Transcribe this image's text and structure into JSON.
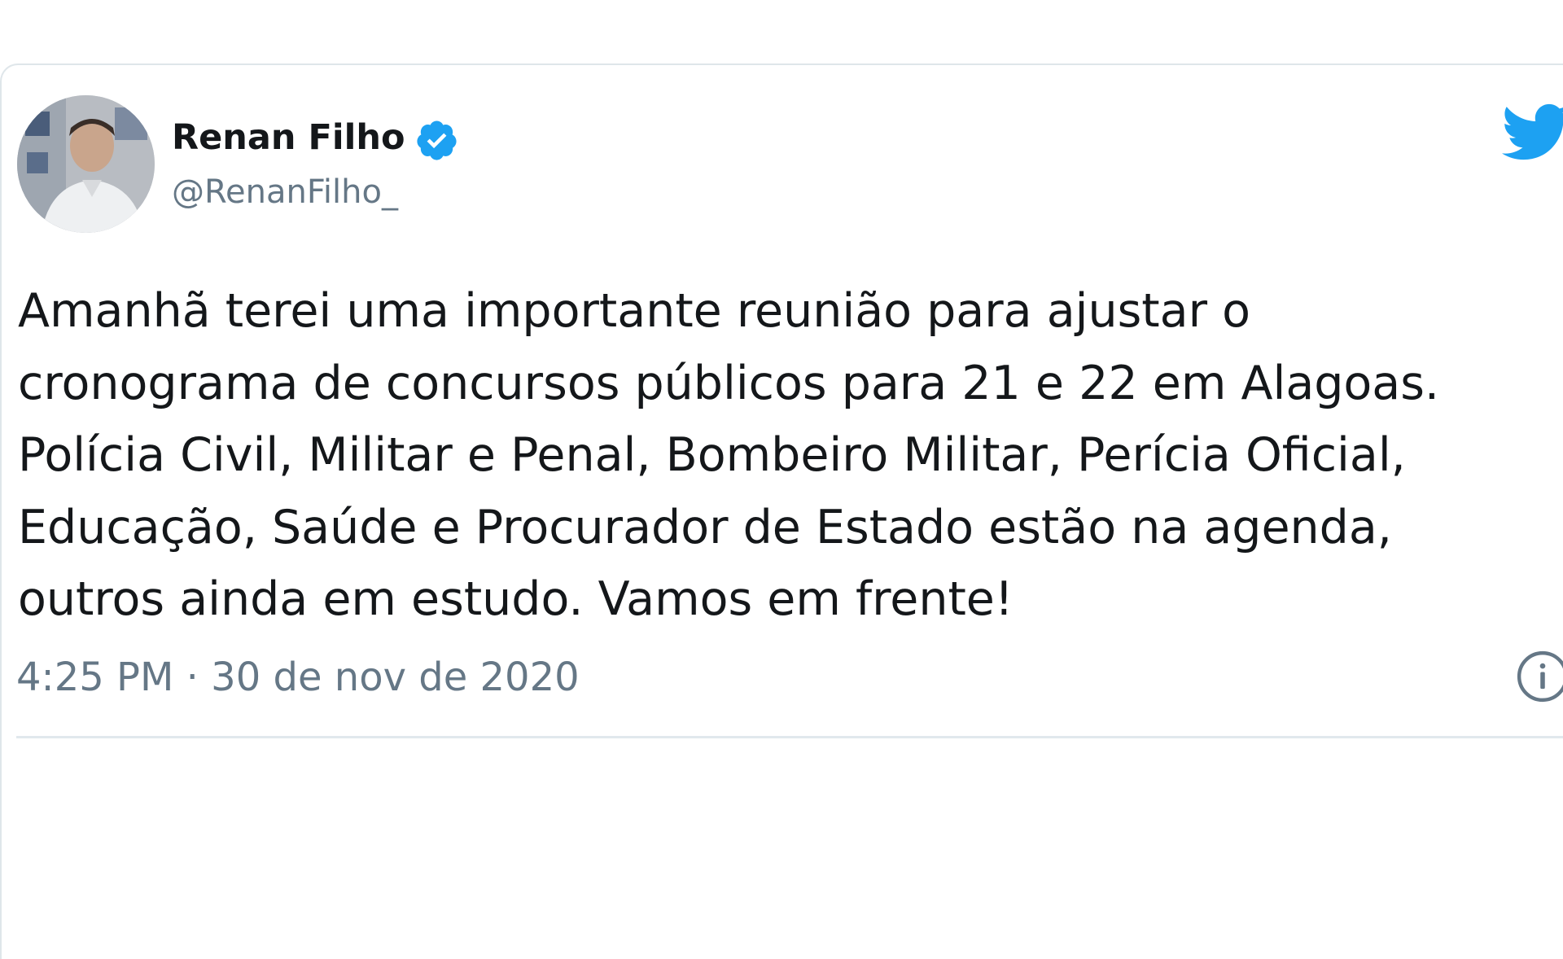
{
  "tweet": {
    "author": {
      "display_name": "Renan Filho",
      "handle": "@RenanFilho_",
      "verified": true,
      "avatar_icon": "user-photo"
    },
    "text_lines": [
      "Amanhã terei uma importante reunião para ajustar o",
      "cronograma de concursos públicos para 21 e 22 em Alagoas.",
      "Polícia Civil, Militar e Penal, Bombeiro Militar, Perícia Oficial,",
      "Educação, Saúde e Procurador de Estado estão na agenda,",
      "outros ainda em estudo. Vamos em frente!"
    ],
    "timestamp": "4:25 PM · 30 de nov de 2020"
  },
  "icons": {
    "logo": "twitter-bird-icon",
    "verified": "verified-badge-icon",
    "info": "info-icon"
  },
  "colors": {
    "brand": "#1da1f2",
    "text_primary": "#14171a",
    "text_secondary": "#657786",
    "divider": "#e1e8ed"
  }
}
